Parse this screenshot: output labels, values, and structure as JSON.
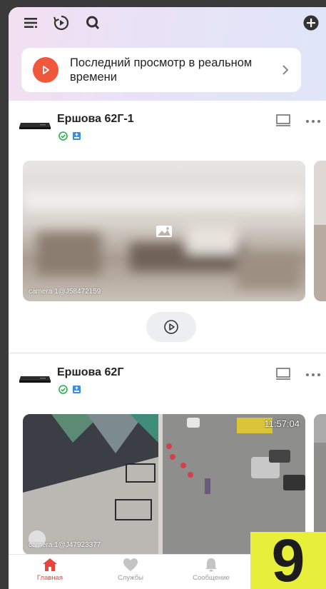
{
  "live": {
    "label": "Последний просмотр в реальном времени"
  },
  "devices": [
    {
      "name": "Ершова 62Г-1",
      "cameras": [
        {
          "label": "camera 1@J58472159"
        }
      ]
    },
    {
      "name": "Ершова 62Г",
      "cameras": [
        {
          "label": "camera 1@J47923377",
          "timestamp": "11:57:04"
        }
      ]
    }
  ],
  "tabs": [
    {
      "label": "Главная",
      "icon": "home-icon",
      "active": true
    },
    {
      "label": "Службы",
      "icon": "heart-icon",
      "active": false
    },
    {
      "label": "Сообщение",
      "icon": "bell-icon",
      "active": false
    }
  ],
  "overlay_badge": "9",
  "colors": {
    "accent": "#e8453c",
    "live_badge": "#f0583c",
    "badge_bg": "#e8ef3a"
  }
}
